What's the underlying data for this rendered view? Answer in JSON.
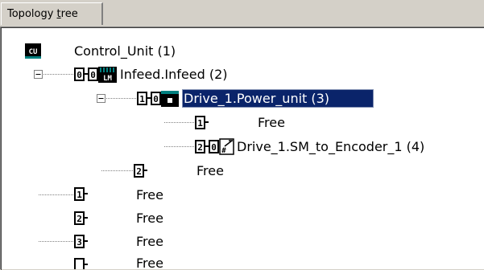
{
  "tab": {
    "label_pre": "Topology ",
    "label_mnemonic": "t",
    "label_post": "ree"
  },
  "tree": {
    "control_unit": "Control_Unit (1)",
    "infeed": "Infeed.Infeed (2)",
    "power_unit": "Drive_1.Power_unit (3)",
    "free": "Free",
    "sm_encoder": "Drive_1.SM_to_Encoder_1 (4)",
    "badge_cu": "CU",
    "badge_lm": "LM",
    "badge_hash": "#",
    "ports": [
      "0",
      "1",
      "2",
      "3"
    ]
  },
  "colors": {
    "selection": "#0a246a",
    "teal": "#008080",
    "tab_bg": "#d4d0c8"
  }
}
